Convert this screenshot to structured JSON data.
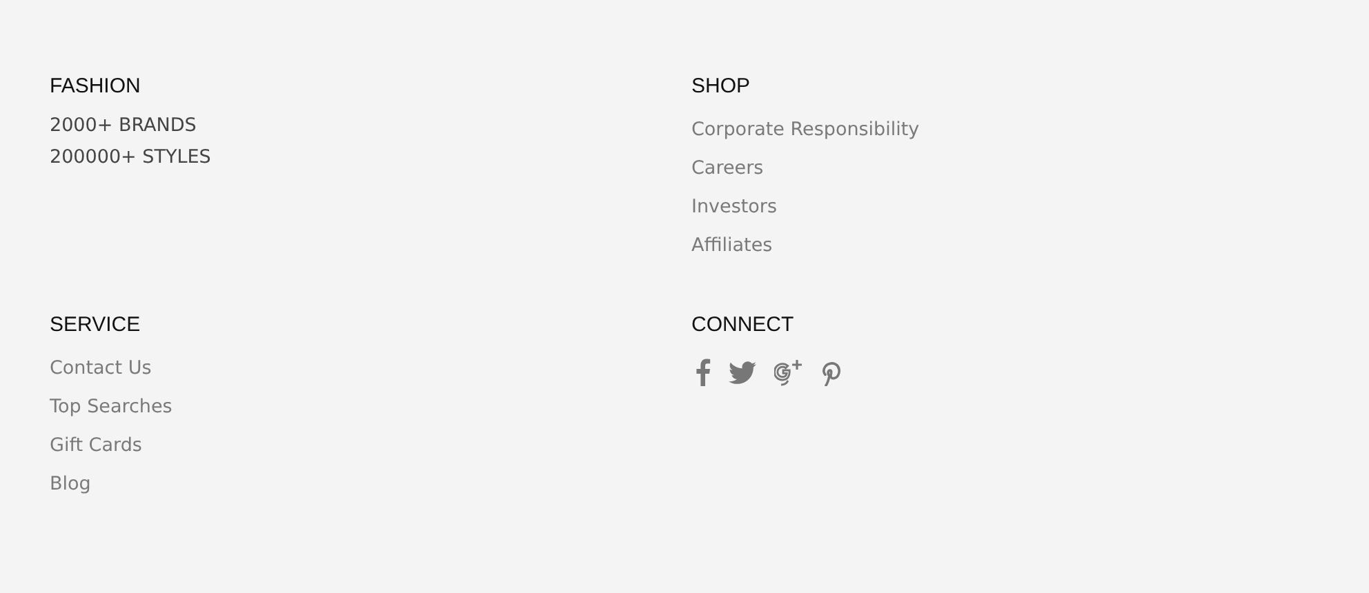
{
  "sections": [
    {
      "heading": "FASHION",
      "kind": "text",
      "items": [
        "2000+ BRANDS",
        "200000+ STYLES"
      ]
    },
    {
      "heading": "SHOP",
      "kind": "links",
      "items": [
        "Corporate Responsibility",
        "Careers",
        "Investors",
        "Affiliates"
      ]
    },
    {
      "heading": "SERVICE",
      "kind": "links",
      "items": [
        "Contact Us",
        "Top Searches",
        "Gift Cards",
        "Blog"
      ]
    },
    {
      "heading": "CONNECT",
      "kind": "social",
      "icons": [
        {
          "kind": "facebook"
        },
        {
          "kind": "twitter"
        },
        {
          "kind": "googleplus"
        },
        {
          "kind": "pinterest"
        }
      ]
    }
  ]
}
